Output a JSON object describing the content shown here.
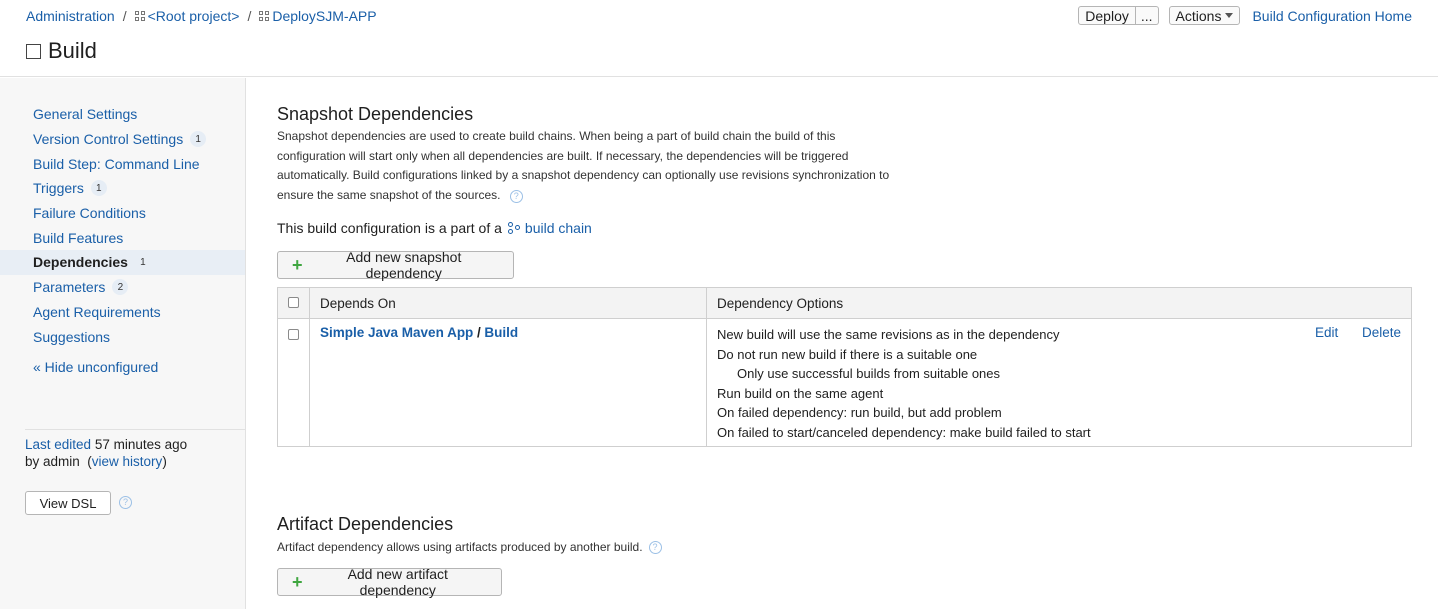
{
  "breadcrumb": {
    "admin": "Administration",
    "root": "<Root project>",
    "project": "DeploySJM-APP",
    "sep": "/"
  },
  "page_title": "Build",
  "top_actions": {
    "deploy": "Deploy",
    "more": "...",
    "actions": "Actions",
    "home": "Build Configuration Home"
  },
  "sidebar": {
    "items": [
      {
        "label": "General Settings",
        "badge": ""
      },
      {
        "label": "Version Control Settings",
        "badge": "1"
      },
      {
        "label": "Build Step: Command Line",
        "badge": ""
      },
      {
        "label": "Triggers",
        "badge": "1"
      },
      {
        "label": "Failure Conditions",
        "badge": ""
      },
      {
        "label": "Build Features",
        "badge": ""
      },
      {
        "label": "Dependencies",
        "badge": "1"
      },
      {
        "label": "Parameters",
        "badge": "2"
      },
      {
        "label": "Agent Requirements",
        "badge": ""
      },
      {
        "label": "Suggestions",
        "badge": ""
      }
    ],
    "hide_unconfigured": "« Hide unconfigured",
    "last_edited_label": "Last edited",
    "last_edited_time": "57 minutes ago",
    "by_admin": "by admin",
    "view_history": "view history",
    "view_dsl": "View DSL"
  },
  "snapshot": {
    "title": "Snapshot Dependencies",
    "description_1": "Snapshot dependencies are used to create build chains. When being a part of build chain the build of this",
    "description_2": "configuration will start only when all dependencies are built. If necessary, the dependencies will be triggered",
    "description_3": "automatically. Build configurations linked by a snapshot dependency can optionally use revisions synchronization to",
    "description_4": "ensure the same snapshot of the sources.",
    "chain_text": "This build configuration is a part of a",
    "chain_link": "build chain",
    "add_button": "Add new snapshot dependency",
    "table": {
      "header_depends": "Depends On",
      "header_options": "Dependency Options",
      "row": {
        "project": "Simple Java Maven App",
        "slash": "/",
        "build": "Build",
        "options": [
          "New build will use the same revisions as in the dependency",
          "Do not run new build if there is a suitable one",
          "Only use successful builds from suitable ones",
          "Run build on the same agent",
          "On failed dependency: run build, but add problem",
          "On failed to start/canceled dependency: make build failed to start"
        ],
        "edit": "Edit",
        "delete": "Delete"
      }
    }
  },
  "artifact": {
    "title": "Artifact Dependencies",
    "description": "Artifact dependency allows using artifacts produced by another build.",
    "add_button": "Add new artifact dependency"
  },
  "colors": {
    "link": "#1a5fa8",
    "plus": "#3fa640",
    "sidebar_bg": "#f7f7f7",
    "active_bg": "#e8eef5"
  }
}
